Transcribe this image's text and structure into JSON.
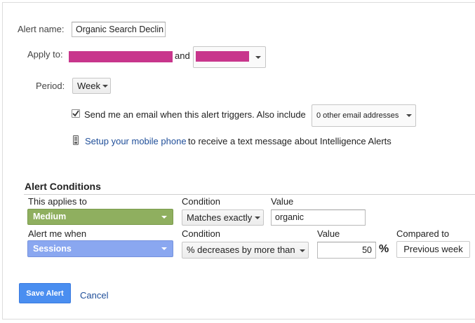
{
  "form": {
    "alert_name_label": "Alert name:",
    "alert_name_value": "Organic Search Declin",
    "apply_to_label": "Apply to:",
    "apply_to_connector": "and",
    "period_label": "Period:",
    "period_value": "Week",
    "email_checkbox_checked": true,
    "email_text": "Send me an email when this alert triggers. Also include",
    "other_emails_value": "0 other email addresses",
    "mobile_link": "Setup your mobile phone",
    "mobile_text": "to receive a text message about Intelligence Alerts"
  },
  "conditions": {
    "title": "Alert Conditions",
    "row1": {
      "applies_header": "This applies to",
      "condition_header": "Condition",
      "value_header": "Value",
      "dimension": "Medium",
      "dimension_color": "#8faf5f",
      "condition": "Matches exactly",
      "value": "organic"
    },
    "row2": {
      "when_header": "Alert me when",
      "condition_header": "Condition",
      "value_header": "Value",
      "compared_header": "Compared to",
      "metric": "Sessions",
      "metric_color": "#8aa7f0",
      "condition": "% decreases by more than",
      "value": "50",
      "unit": "%",
      "compared": "Previous week"
    }
  },
  "actions": {
    "save_label": "Save Alert",
    "cancel_label": "Cancel",
    "save_color": "#4a8ef0"
  }
}
